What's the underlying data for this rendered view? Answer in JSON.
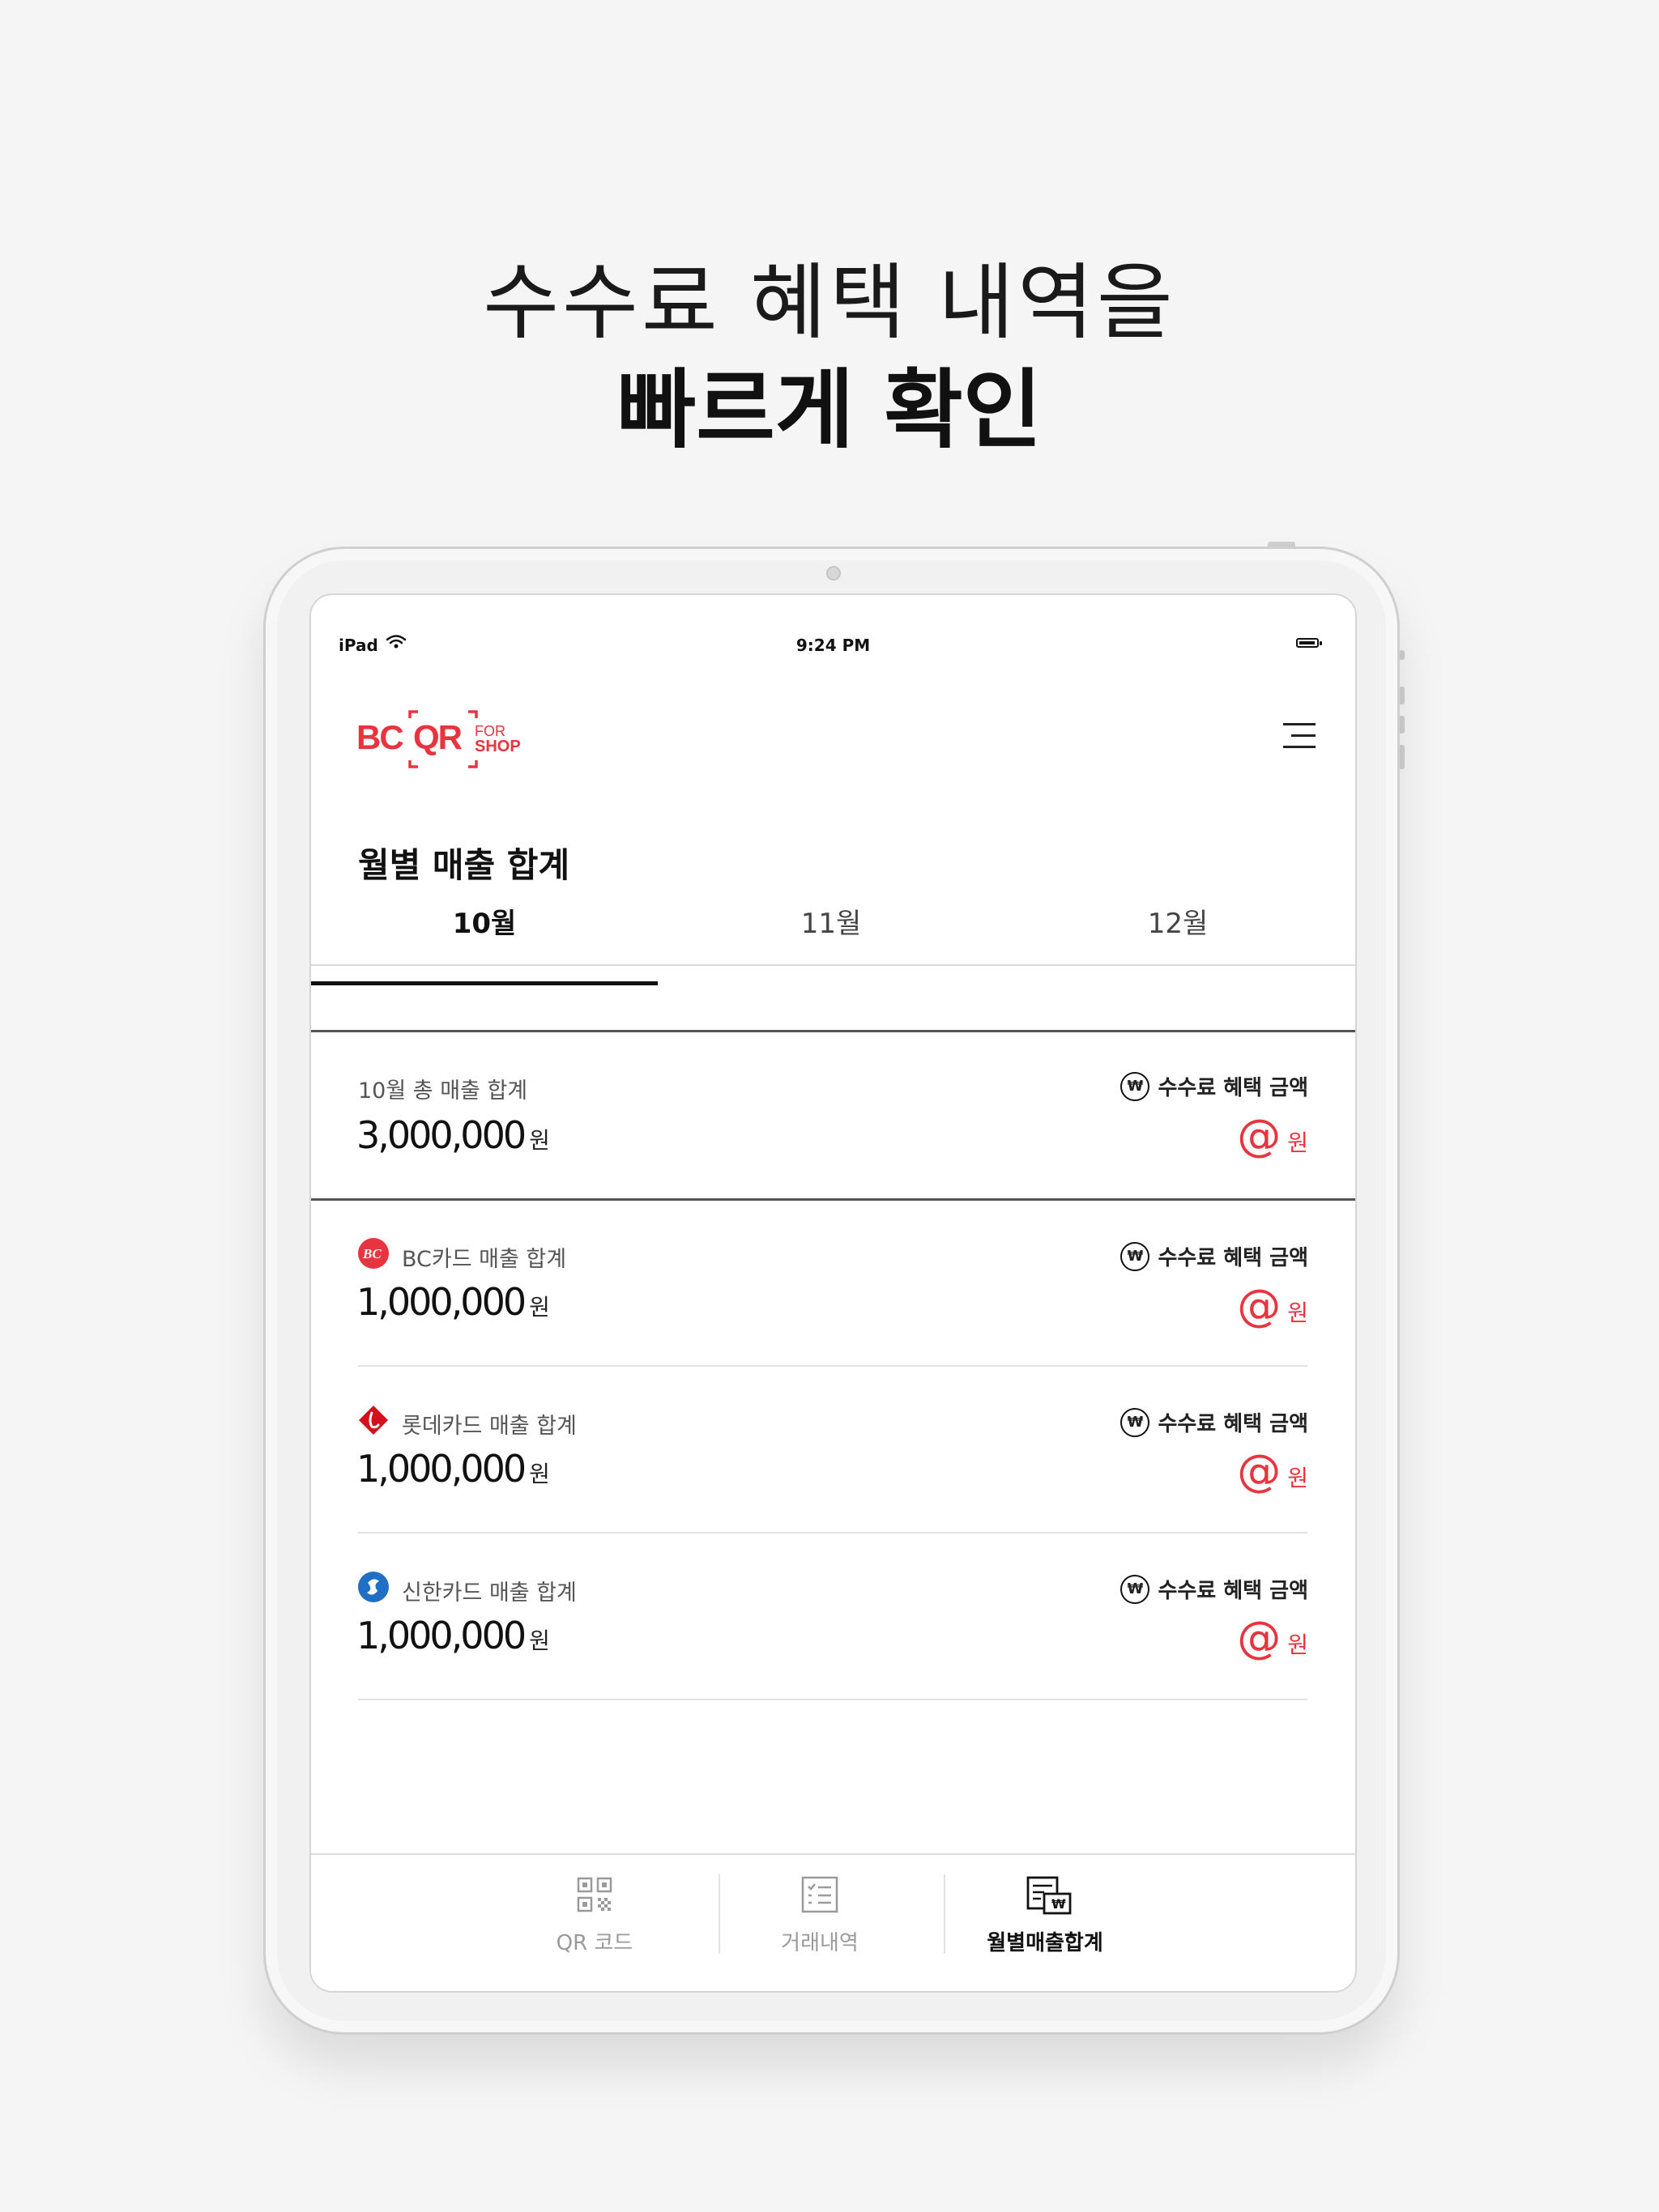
{
  "promo": {
    "line1": "수수료 혜택 내역을",
    "line2": "빠르게 확인"
  },
  "status_bar": {
    "device": "iPad",
    "time": "9:24 PM"
  },
  "header": {
    "logo_text_bc": "BC",
    "logo_text_qr": "QR",
    "logo_text_for": "FOR",
    "logo_text_shop": "SHOP",
    "page_title": "월별 매출 합계"
  },
  "tabs": [
    {
      "label": "10월",
      "active": true
    },
    {
      "label": "11월",
      "active": false
    },
    {
      "label": "12월",
      "active": false
    }
  ],
  "total": {
    "label": "10월 총 매출 합계",
    "amount": "3,000,000",
    "unit": "원",
    "fee_label": "수수료 혜택 금액",
    "fee_value": "@",
    "fee_unit": "원"
  },
  "cards": [
    {
      "label": "BC카드 매출 합계",
      "amount": "1,000,000",
      "unit": "원",
      "fee_label": "수수료 혜택 금액",
      "fee_value": "@",
      "fee_unit": "원",
      "icon": "bc-card-logo-icon"
    },
    {
      "label": "롯데카드 매출 합계",
      "amount": "1,000,000",
      "unit": "원",
      "fee_label": "수수료 혜택 금액",
      "fee_value": "@",
      "fee_unit": "원",
      "icon": "lotte-card-logo-icon"
    },
    {
      "label": "신한카드 매출 합계",
      "amount": "1,000,000",
      "unit": "원",
      "fee_label": "수수료 혜택 금액",
      "fee_value": "@",
      "fee_unit": "원",
      "icon": "shinhan-card-logo-icon"
    }
  ],
  "won_symbol": "₩",
  "bottom_nav": [
    {
      "label": "QR 코드",
      "icon": "qr-code-icon",
      "active": false
    },
    {
      "label": "거래내역",
      "icon": "transaction-list-icon",
      "active": false
    },
    {
      "label": "월별매출합계",
      "icon": "monthly-sales-icon",
      "active": true
    }
  ],
  "colors": {
    "brand_red": "#e8343f",
    "text": "#111111"
  }
}
